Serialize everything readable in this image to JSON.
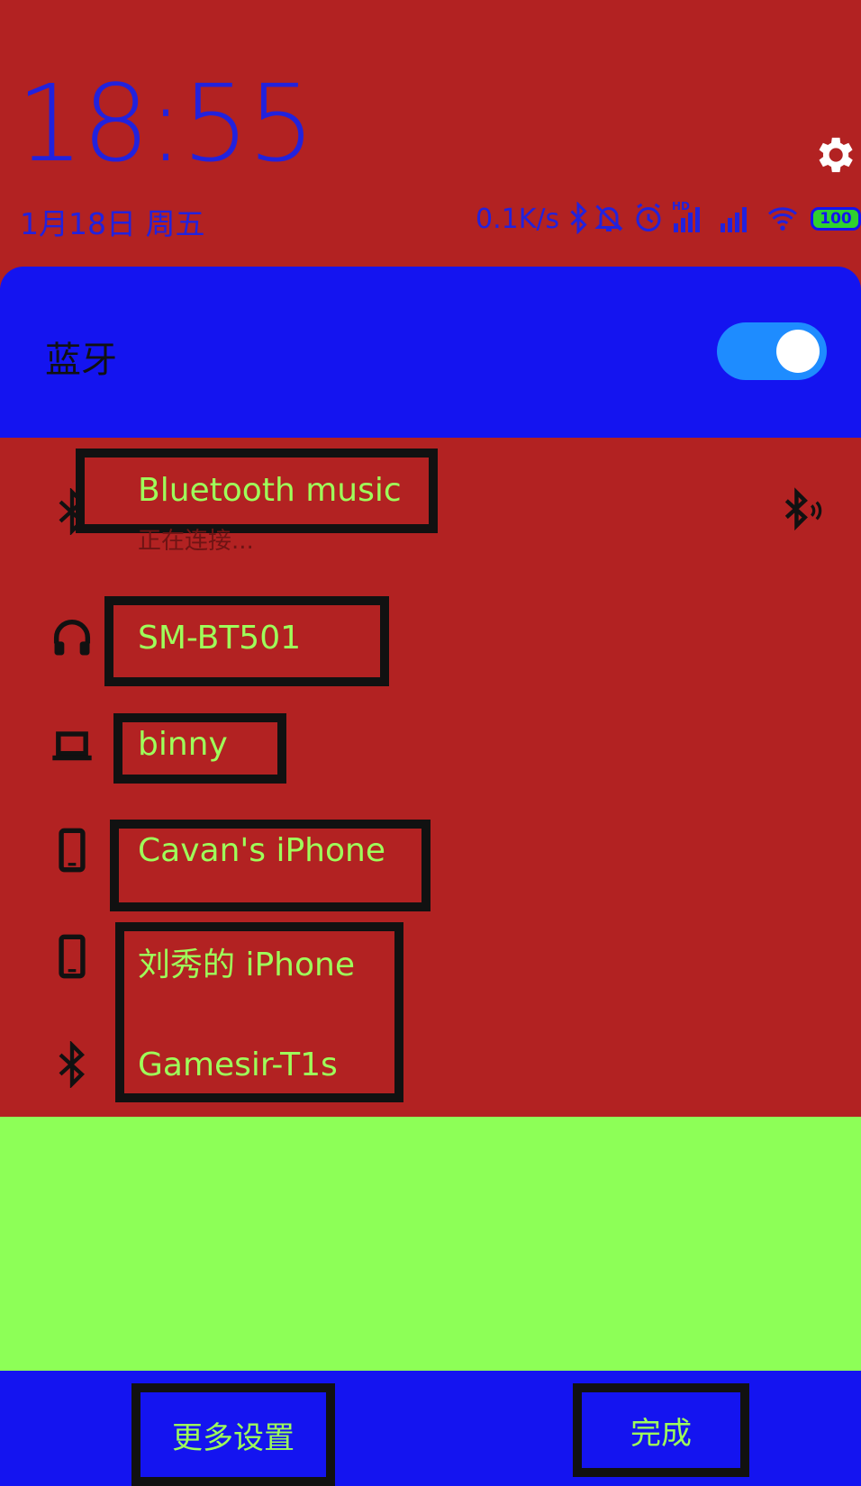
{
  "status_bar": {
    "time": "18:55",
    "date": "1月18日 周五",
    "net_speed": "0.1K/s",
    "hd_label": "HD",
    "battery": "100"
  },
  "bluetooth": {
    "title": "蓝牙",
    "enabled": true
  },
  "devices": [
    {
      "name": "Bluetooth music",
      "status": "正在连接...",
      "icon": "bluetooth-icon"
    },
    {
      "name": "SM-BT501",
      "icon": "headphones-icon"
    },
    {
      "name": "binny",
      "icon": "laptop-icon"
    },
    {
      "name": "Cavan's iPhone",
      "icon": "phone-icon"
    },
    {
      "name": "刘秀的 iPhone",
      "icon": "phone-icon"
    },
    {
      "name": "Gamesir-T1s",
      "icon": "bluetooth-icon"
    }
  ],
  "footer": {
    "more_settings": "更多设置",
    "done": "完成"
  },
  "colors": {
    "background": "#b22222",
    "header": "#1414f0",
    "text_accent": "#9efe5a",
    "empty_area": "#8dff57",
    "toggle": "#1e8cff"
  }
}
